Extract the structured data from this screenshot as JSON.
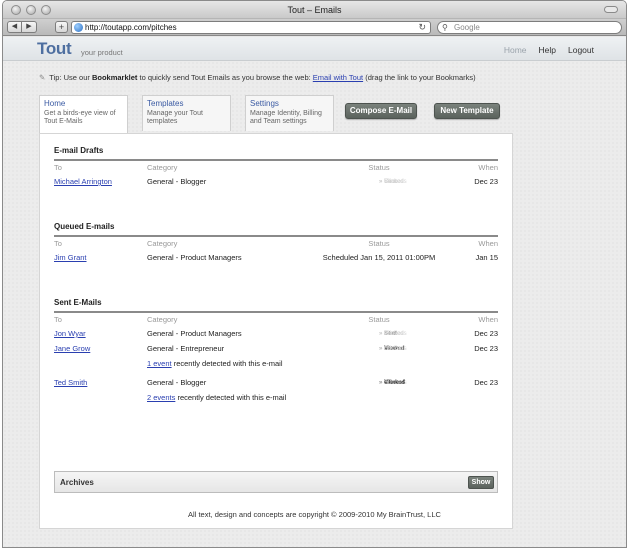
{
  "window": {
    "title": "Tout – Emails"
  },
  "browser": {
    "url": "http://toutapp.com/pitches",
    "search_placeholder": "Google"
  },
  "header": {
    "logo": "Tout",
    "tagline": "your product",
    "nav": {
      "home": "Home",
      "help": "Help",
      "logout": "Logout"
    }
  },
  "tip": {
    "prefix": "Tip: Use our",
    "bold": "Bookmarklet",
    "middle": "to quickly send Tout Emails as you browse the web:",
    "link": "Email with Tout",
    "suffix": "(drag the link to your Bookmarks)"
  },
  "tabs": [
    {
      "label": "Home",
      "desc": "Get a birds-eye view of Tout E-Mails"
    },
    {
      "label": "Templates",
      "desc": "Manage your Tout templates"
    },
    {
      "label": "Settings",
      "desc": "Manage Identity, Billing and Team settings"
    }
  ],
  "actions": {
    "compose": "Compose E-Mail",
    "new_template": "New Template"
  },
  "columns": {
    "to": "To",
    "category": "Category",
    "status": "Status",
    "when": "When"
  },
  "statuses": {
    "sent": "Sent",
    "viewed": "Viewed",
    "clicked": "Clicked",
    "success": "Success"
  },
  "drafts": {
    "title": "E-mail Drafts",
    "rows": [
      {
        "to": "Michael Arrington",
        "category": "General - Blogger",
        "when": "Dec 23"
      }
    ]
  },
  "queued": {
    "title": "Queued E-mails",
    "rows": [
      {
        "to": "Jim Grant",
        "category": "General - Product Managers",
        "status": "Scheduled Jan 15, 2011 01:00PM",
        "when": "Jan 15"
      }
    ]
  },
  "sent": {
    "title": "Sent E-Mails",
    "rows": [
      {
        "to": "Jon Wyar",
        "category": "General - Product Managers",
        "when": "Dec 23"
      },
      {
        "to": "Jane Grow",
        "category": "General - Entrepreneur",
        "when": "Dec 23",
        "events_link": "1 event",
        "events_text": "recently detected with this e-mail"
      },
      {
        "to": "Ted Smith",
        "category": "General - Blogger",
        "when": "Dec 23",
        "events_link": "2 events",
        "events_text": "recently detected with this e-mail"
      }
    ]
  },
  "archives": {
    "title": "Archives",
    "show": "Show"
  },
  "footer": "All text, design and concepts are copyright © 2009-2010 My BrainTrust, LLC"
}
